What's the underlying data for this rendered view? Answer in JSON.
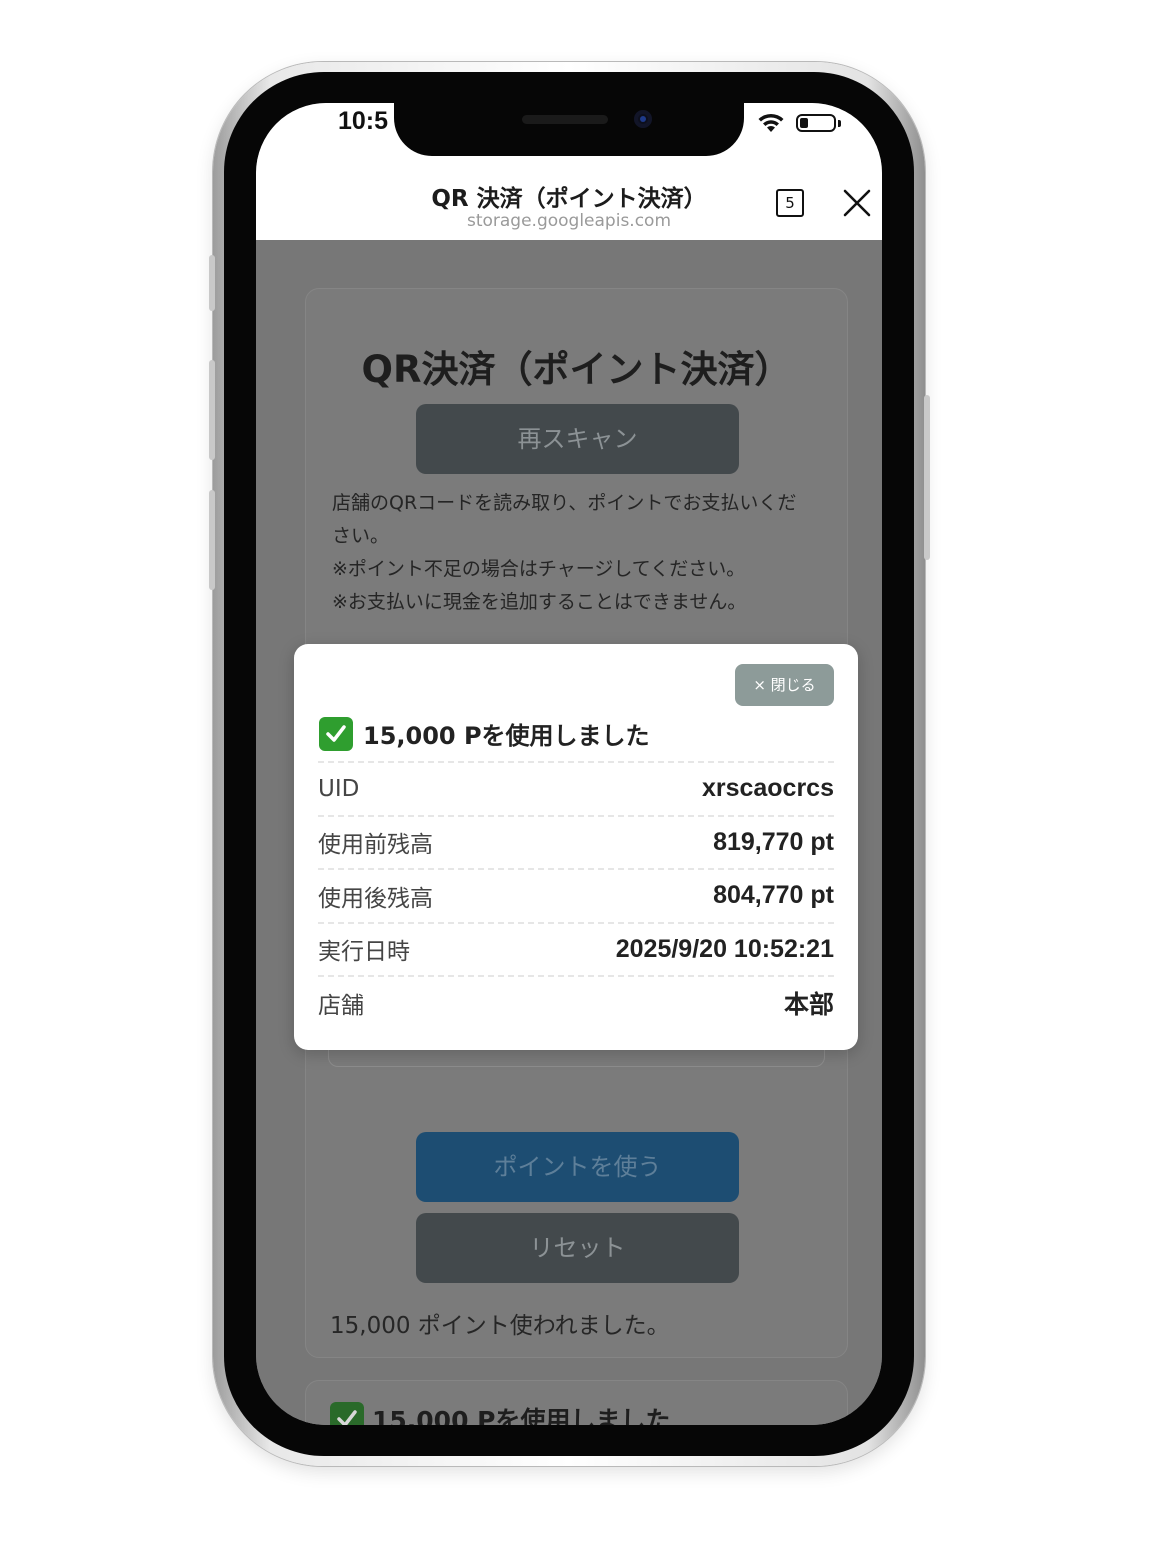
{
  "status_bar": {
    "time": "10:5"
  },
  "browser": {
    "title": "QR 決済（ポイント決済）",
    "url": "storage.googleapis.com",
    "tab_count": "5"
  },
  "page": {
    "title": "QR決済（ポイント決済）",
    "rescan_label": "再スキャン",
    "description": [
      "店舗のQRコードを読み取り、ポイントでお支払いくだ",
      "さい。",
      "※ポイント不足の場合はチャージしてください。",
      "※お支払いに現金を追加することはできません。"
    ],
    "use_points_label": "ポイントを使う",
    "reset_label": "リセット",
    "used_message": "15,000 ポイント使われました。",
    "history_title": "15,000 Pを使用しました"
  },
  "modal": {
    "close_label": "× 閉じる",
    "title": "15,000 Pを使用しました",
    "rows": [
      {
        "label": "UID",
        "value": "xrscaocrcs"
      },
      {
        "label": "使用前残高",
        "value": "819,770 pt"
      },
      {
        "label": "使用後残高",
        "value": "804,770 pt"
      },
      {
        "label": "実行日時",
        "value": "2025/9/20 10:52:21"
      },
      {
        "label": "店舗",
        "value": "本部"
      }
    ]
  },
  "icons": {
    "success": "check-mark-icon",
    "close": "close-icon",
    "tabs": "tabs-icon",
    "wifi": "wifi-icon",
    "battery": "battery-icon"
  },
  "colors": {
    "success_green": "#2f9e2f",
    "primary_button": "#1d4d72",
    "secondary_button": "#43494c",
    "close_button": "#8d9b99"
  }
}
